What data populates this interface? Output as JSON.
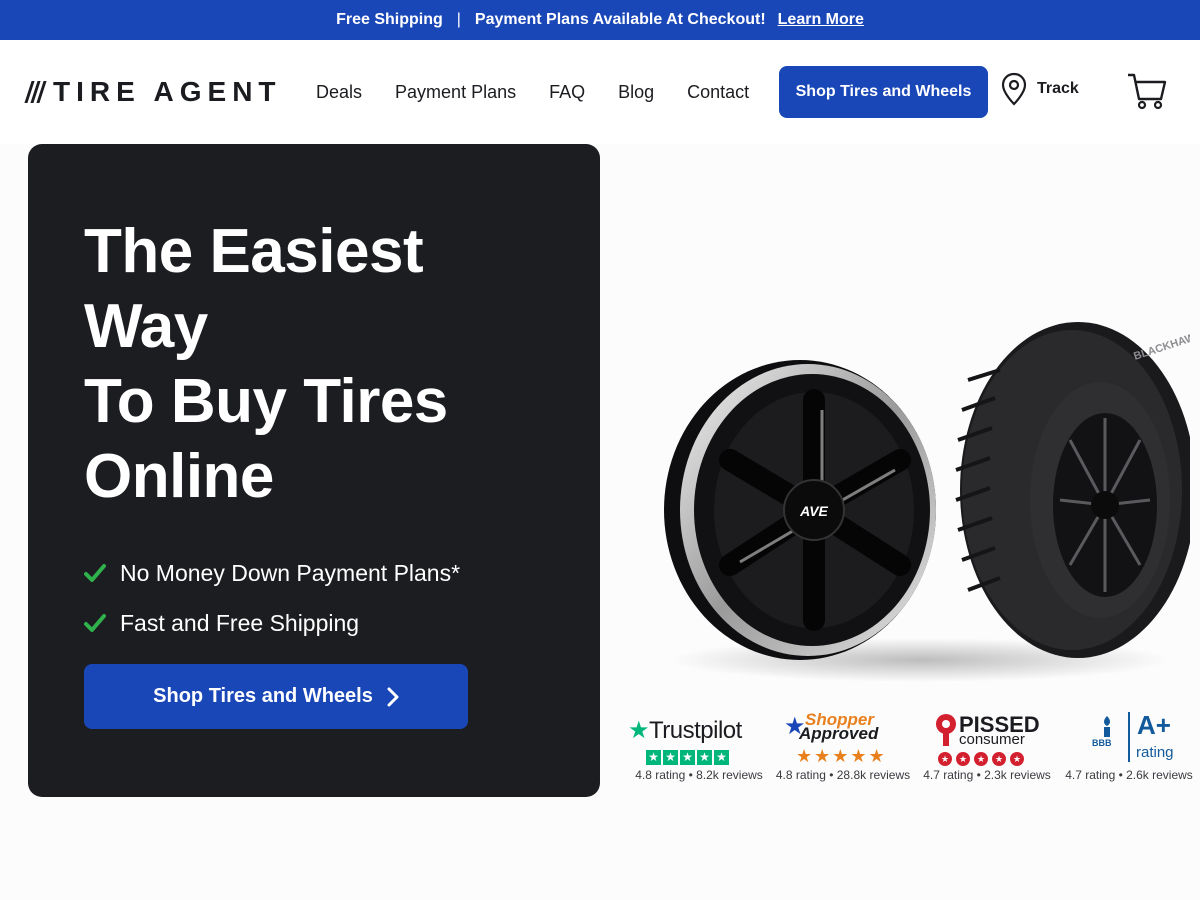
{
  "promo": {
    "shipping": "Free Shipping",
    "separator": "|",
    "payment": "Payment Plans Available At Checkout!",
    "learn_more": "Learn More"
  },
  "header": {
    "logo_text": "TIRE AGENT",
    "nav": [
      "Deals",
      "Payment Plans",
      "FAQ",
      "Blog",
      "Contact"
    ],
    "shop_button": "Shop Tires and Wheels",
    "track_label": "Track"
  },
  "hero": {
    "title_lines": [
      "The Easiest",
      "Way",
      "To Buy Tires",
      "Online"
    ],
    "features": [
      "No Money Down Payment Plans*",
      "Fast and Free Shipping"
    ],
    "cta": "Shop Tires and Wheels",
    "wheel_brand": "AVE",
    "tire_brand": "BLACKHAWK"
  },
  "ratings": [
    {
      "name": "Trustpilot",
      "meta": "4.8 rating • 8.2k reviews"
    },
    {
      "name": "Shopper Approved",
      "name_parts": [
        "Shopper",
        "Approved"
      ],
      "meta": "4.8 rating • 28.8k reviews"
    },
    {
      "name": "PISSED consumer",
      "name_parts": [
        "PISSED",
        "consumer"
      ],
      "meta": "4.7 rating • 2.3k reviews"
    },
    {
      "name": "BBB A+ rating",
      "grade": "A+",
      "label": "rating",
      "bbb": "BBB",
      "meta": "4.7 rating • 2.6k reviews"
    }
  ],
  "colors": {
    "brand_blue": "#1a47b8",
    "hero_dark": "#1c1d21",
    "check_green": "#2fb24b",
    "trustpilot_green": "#00b67a",
    "shopper_orange": "#e8801d",
    "pissed_red": "#d3202f",
    "bbb_blue": "#125a9c"
  },
  "icons": {
    "location": "map-pin-icon",
    "cart": "shopping-cart-icon",
    "check": "check-icon",
    "arrow": "chevron-right-icon"
  }
}
